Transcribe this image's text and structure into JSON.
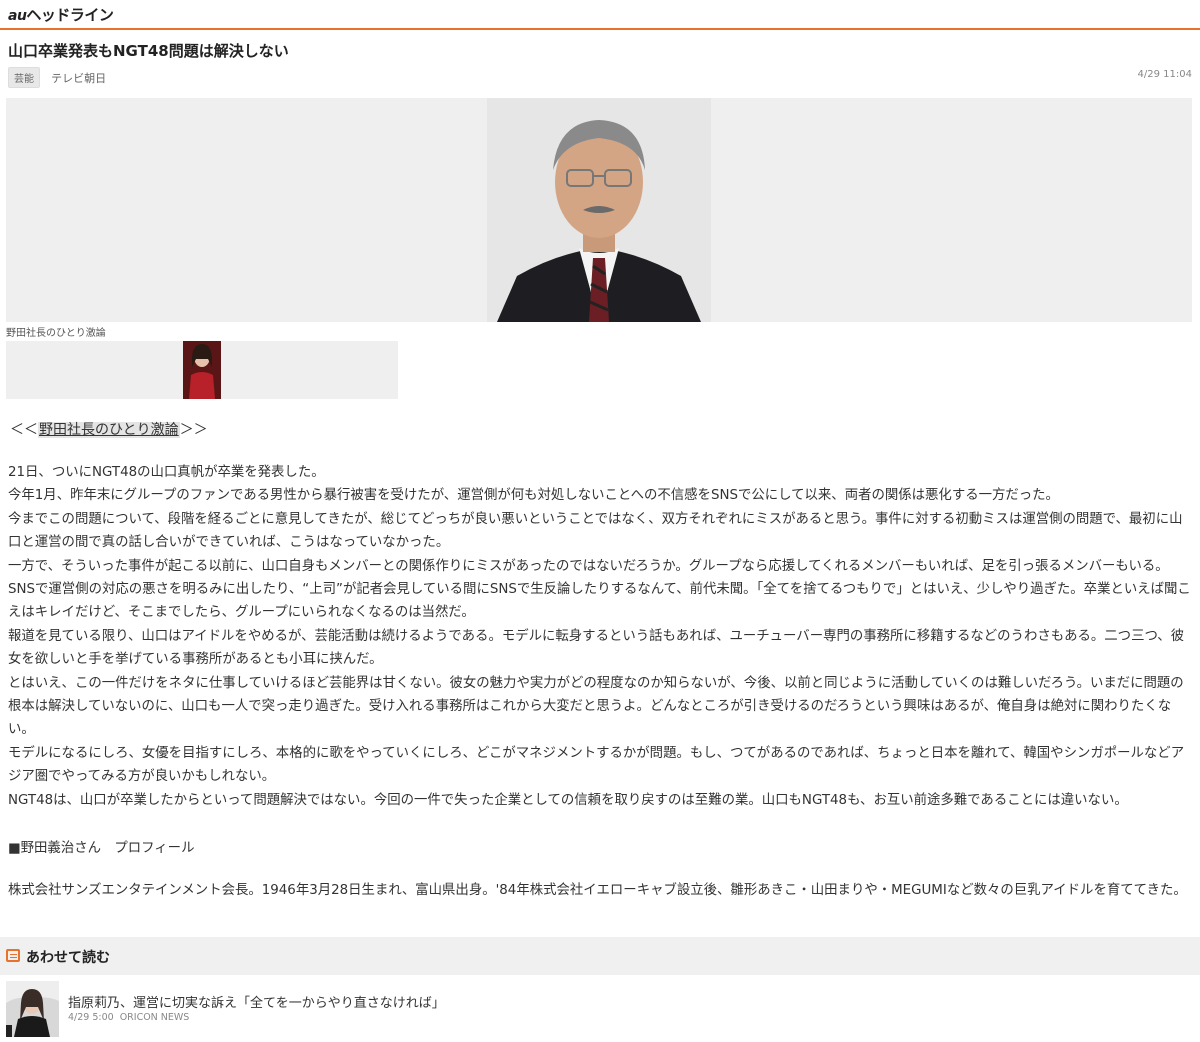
{
  "header": {
    "logo_prefix": "au",
    "logo_text": "ヘッドライン"
  },
  "article": {
    "title": "山口卒業発表もNGT48問題は解決しない",
    "category": "芸能",
    "source": "テレビ朝日",
    "datetime": "4/29 11:04",
    "photo_caption": "野田社長のひとり激論",
    "column_link_prefix": "＜＜",
    "column_link": "野田社長のひとり激論",
    "column_link_suffix": "＞＞",
    "paragraphs": [
      "21日、ついにNGT48の山口真帆が卒業を発表した。",
      "今年1月、昨年末にグループのファンである男性から暴行被害を受けたが、運営側が何も対処しないことへの不信感をSNSで公にして以来、両者の関係は悪化する一方だった。",
      "今までこの問題について、段階を経るごとに意見してきたが、総じてどっちが良い悪いということではなく、双方それぞれにミスがあると思う。事件に対する初動ミスは運営側の問題で、最初に山口と運営の間で真の話し合いができていれば、こうはなっていなかった。",
      "一方で、そういった事件が起こる以前に、山口自身もメンバーとの関係作りにミスがあったのではないだろうか。グループなら応援してくれるメンバーもいれば、足を引っ張るメンバーもいる。SNSで運営側の対応の悪さを明るみに出したり、“上司”が記者会見している間にSNSで生反論したりするなんて、前代未聞。「全てを捨てるつもりで」とはいえ、少しやり過ぎた。卒業といえば聞こえはキレイだけど、そこまでしたら、グループにいられなくなるのは当然だ。",
      "報道を見ている限り、山口はアイドルをやめるが、芸能活動は続けるようである。モデルに転身するという話もあれば、ユーチューバー専門の事務所に移籍するなどのうわさもある。二つ三つ、彼女を欲しいと手を挙げている事務所があるとも小耳に挟んだ。",
      "とはいえ、この一件だけをネタに仕事していけるほど芸能界は甘くない。彼女の魅力や実力がどの程度なのか知らないが、今後、以前と同じように活動していくのは難しいだろう。いまだに問題の根本は解決していないのに、山口も一人で突っ走り過ぎた。受け入れる事務所はこれから大変だと思うよ。どんなところが引き受けるのだろうという興味はあるが、俺自身は絶対に関わりたくない。",
      "モデルになるにしろ、女優を目指すにしろ、本格的に歌をやっていくにしろ、どこがマネジメントするかが問題。もし、つてがあるのであれば、ちょっと日本を離れて、韓国やシンガポールなどアジア圏でやってみる方が良いかもしれない。",
      "NGT48は、山口が卒業したからといって問題解決ではない。今回の一件で失った企業としての信頼を取り戻すのは至難の業。山口もNGT48も、お互い前途多難であることには違いない。"
    ],
    "profile_heading": "■野田義治さん　プロフィール",
    "profile_text": "株式会社サンズエンタテインメント会長。1946年3月28日生まれ、富山県出身。'84年株式会社イエローキャブ設立後、雛形あきこ・山田まりや・MEGUMIなど数々の巨乳アイドルを育ててきた。"
  },
  "related": {
    "heading": "あわせて読む",
    "items": [
      {
        "title": "指原莉乃、運営に切実な訴え「全てを一からやり直さなければ」",
        "time": "4/29 5:00",
        "source": "ORICON NEWS"
      }
    ]
  },
  "colors": {
    "accent": "#e8712c",
    "panel": "#efefef",
    "text": "#333333"
  }
}
